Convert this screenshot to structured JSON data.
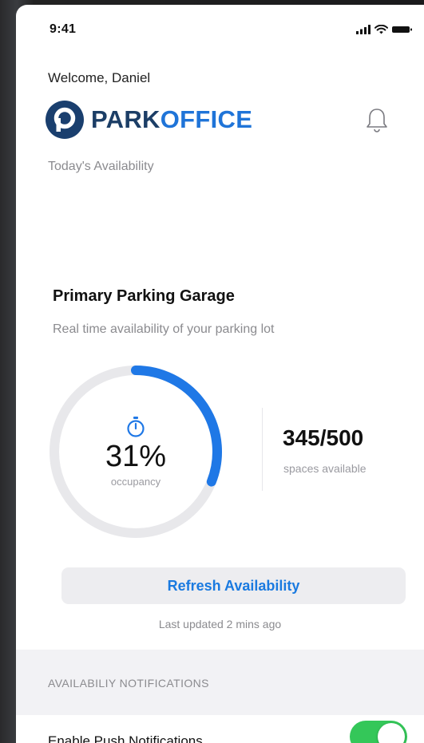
{
  "status_bar": {
    "time": "9:41"
  },
  "header": {
    "welcome": "Welcome, Daniel",
    "brand_part1": "PARK",
    "brand_part2": "OFFICE",
    "today_label": "Today's Availability"
  },
  "card": {
    "title": "Primary Parking Garage",
    "subtitle": "Real time availability of your parking lot",
    "occupancy_percent": "31%",
    "occupancy_fraction": 0.31,
    "occupancy_label": "occupancy",
    "spaces_value": "345/500",
    "spaces_label": "spaces available",
    "refresh_label": "Refresh Availability",
    "last_updated": "Last updated 2 mins ago"
  },
  "notifications": {
    "section_title": "AVAILABILIY NOTIFICATIONS",
    "push_label": "Enable Push Notifications",
    "push_enabled": true
  },
  "icons": {
    "brand_logo": "parkoffice-logo",
    "bell": "bell-icon",
    "timer": "stopwatch-icon",
    "signal": "cellular-signal-icon",
    "wifi": "wifi-icon",
    "battery": "battery-icon"
  },
  "colors": {
    "accent": "#1f74d8",
    "brand_dark": "#1c3e66",
    "ring_track": "#e8e8eb",
    "toggle_on": "#34c759"
  }
}
